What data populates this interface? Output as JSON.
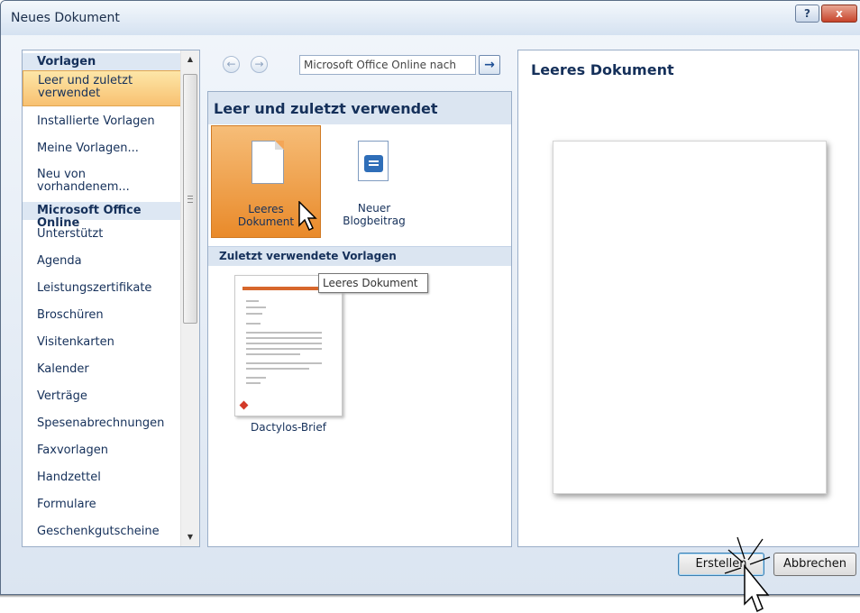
{
  "dialog": {
    "title": "Neues Dokument",
    "help_glyph": "?",
    "close_glyph": "x"
  },
  "categories": [
    {
      "label": "Vorlagen",
      "type": "header"
    },
    {
      "label": "Leer und zuletzt verwendet",
      "type": "selected"
    },
    {
      "label": "Installierte Vorlagen",
      "type": "item"
    },
    {
      "label": "Meine Vorlagen...",
      "type": "item"
    },
    {
      "label": "Neu von vorhandenem...",
      "type": "item"
    },
    {
      "label": "Microsoft Office Online",
      "type": "header"
    },
    {
      "label": "Unterstützt",
      "type": "item"
    },
    {
      "label": "Agenda",
      "type": "item"
    },
    {
      "label": "Leistungszertifikate",
      "type": "item"
    },
    {
      "label": "Broschüren",
      "type": "item"
    },
    {
      "label": "Visitenkarten",
      "type": "item"
    },
    {
      "label": "Kalender",
      "type": "item"
    },
    {
      "label": "Verträge",
      "type": "item"
    },
    {
      "label": "Spesenabrechnungen",
      "type": "item"
    },
    {
      "label": "Faxvorlagen",
      "type": "item"
    },
    {
      "label": "Handzettel",
      "type": "item"
    },
    {
      "label": "Formulare",
      "type": "item"
    },
    {
      "label": "Geschenkgutscheine",
      "type": "item"
    }
  ],
  "search": {
    "value": "Microsoft Office Online nach",
    "go_glyph": "→",
    "back_glyph": "←",
    "forward_glyph": "→"
  },
  "middle": {
    "section_title": "Leer und zuletzt verwendet",
    "tiles": [
      {
        "line1": "Leeres",
        "line2": "Dokument",
        "icon": "blank-document-icon"
      },
      {
        "line1": "Neuer",
        "line2": "Blogbeitrag",
        "icon": "blog-post-icon"
      }
    ],
    "recent_title": "Zuletzt verwendete Vorlagen",
    "recent_templates": [
      {
        "label": "Dactylos-Brief"
      }
    ],
    "tooltip": "Leeres Dokument"
  },
  "preview": {
    "title": "Leeres Dokument"
  },
  "buttons": {
    "create": "Erstellen",
    "cancel": "Abbrechen"
  },
  "colors": {
    "accent_orange": "#e98a2a",
    "section_blue": "#dbe5f1",
    "text_blue": "#15305a"
  }
}
